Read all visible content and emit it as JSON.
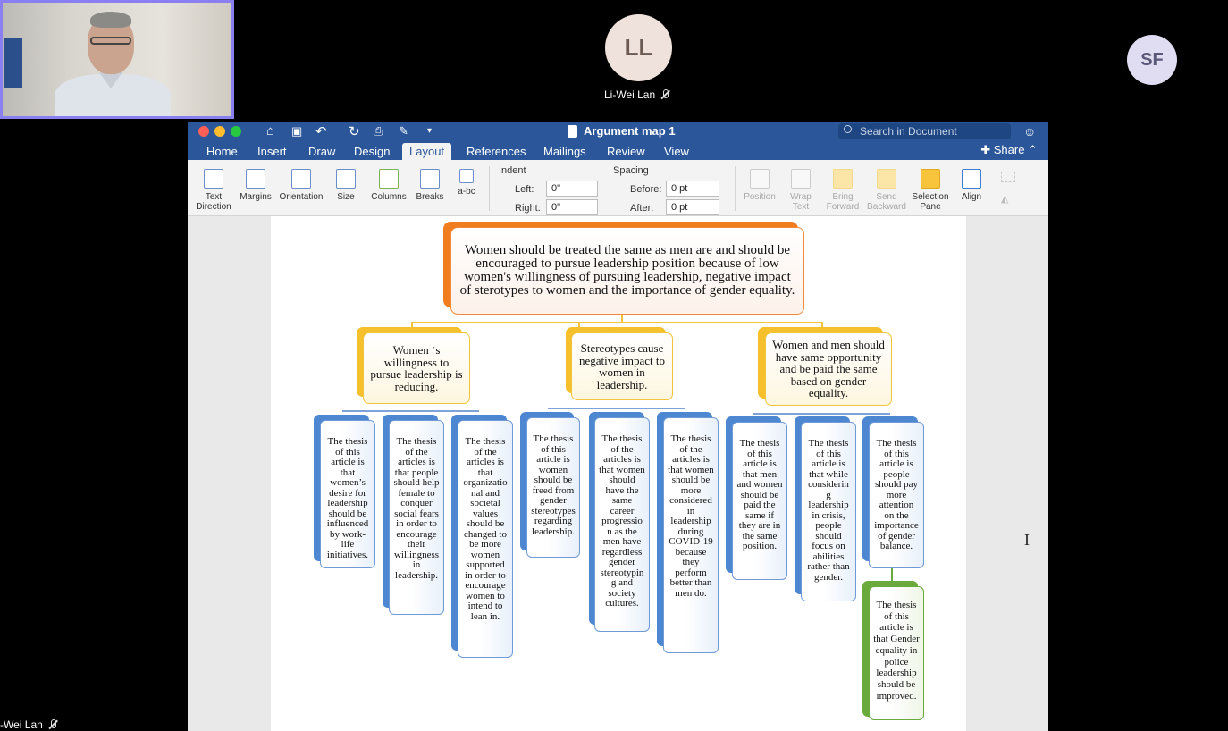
{
  "meeting": {
    "participant_ll_initials": "LL",
    "participant_ll_name": "Li-Wei Lan",
    "participant_sf_initials": "SF",
    "self_name_label": "-Wei Lan"
  },
  "word": {
    "title": "Argument map 1",
    "search_placeholder": "Search in Document",
    "tabs": [
      "Home",
      "Insert",
      "Draw",
      "Design",
      "Layout",
      "References",
      "Mailings",
      "Review",
      "View"
    ],
    "active_tab": "Layout",
    "share_label": "Share",
    "ribbon": {
      "text_direction": [
        "Text",
        "Direction"
      ],
      "margins": "Margins",
      "orientation": "Orientation",
      "size": "Size",
      "columns": "Columns",
      "breaks": "Breaks",
      "hyphenation": "a-bc",
      "indent_label": "Indent",
      "left_label": "Left:",
      "left_value": "0\"",
      "right_label": "Right:",
      "right_value": "0\"",
      "spacing_label": "Spacing",
      "before_label": "Before:",
      "before_value": "0 pt",
      "after_label": "After:",
      "after_value": "0 pt",
      "position": "Position",
      "wrap_text": [
        "Wrap",
        "Text"
      ],
      "bring_forward": [
        "Bring",
        "Forward"
      ],
      "send_backward": [
        "Send",
        "Backward"
      ],
      "selection_pane": [
        "Selection",
        "Pane"
      ],
      "align": "Align"
    }
  },
  "map": {
    "thesis": "Women should be treated the same as men are and should be encouraged to pursue leadership position because of low women's willingness of pursuing leadership, negative impact of sterotypes to women and the importance of gender equality.",
    "claims": [
      "Women ‘s willingness to pursue leadership is reducing.",
      "Stereotypes cause negative impact to women in leadership.",
      "Women and men should have same opportunity and be paid the same based on gender equality."
    ],
    "evidence": [
      "The thesis of this article is that women’s desire for leadership should be influenced by work-life initiatives.",
      "The thesis of the articles is that people should help female to conquer social fears in order to encourage their willingness in leadership.",
      "The thesis of the articles is that organizatio nal and societal values should be changed to be more women supported in order to encourage women to intend to lean in.",
      "The thesis of this article is women should be freed from gender stereotypes regarding leadership.",
      "The thesis of the articles is that women should have the same career progressio n as the men have regardless gender stereotypin g and society cultures.",
      "The thesis of the articles is that women should be more considered in leadership during COVID-19 because they perform better than men do.",
      "The thesis of this article is that men and women should be paid the same if they are in the same position.",
      "The thesis of this article is that while considerin g leadership in crisis, people should focus on abilities rather than gender.",
      "The thesis of this article is people should pay more attention on the importance of gender balance."
    ],
    "sub_evidence": "The thesis of this article is that Gender equality in police leadership should be improved."
  }
}
